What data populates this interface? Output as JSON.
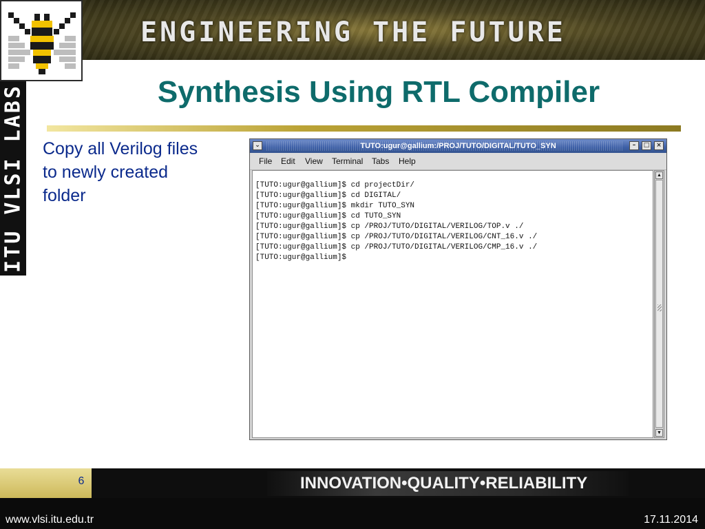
{
  "header": {
    "tagline": "ENGINEERING THE FUTURE",
    "vertical_label": "ITU VLSI LABS"
  },
  "slide": {
    "title": "Synthesis Using RTL Compiler",
    "body_lines": [
      "Copy all Verilog files",
      "to newly created",
      "folder"
    ]
  },
  "terminal": {
    "window_title": "TUTO:ugur@gallium:/PROJ/TUTO/DIGITAL/TUTO_SYN",
    "menu": [
      {
        "label": "File"
      },
      {
        "label": "Edit"
      },
      {
        "label": "View"
      },
      {
        "label": "Terminal"
      },
      {
        "label": "Tabs"
      },
      {
        "label": "Help"
      }
    ],
    "lines": [
      "[TUTO:ugur@gallium]$ cd projectDir/",
      "[TUTO:ugur@gallium]$ cd DIGITAL/",
      "[TUTO:ugur@gallium]$ mkdir TUTO_SYN",
      "[TUTO:ugur@gallium]$ cd TUTO_SYN",
      "[TUTO:ugur@gallium]$ cp /PROJ/TUTO/DIGITAL/VERILOG/TOP.v ./",
      "[TUTO:ugur@gallium]$ cp /PROJ/TUTO/DIGITAL/VERILOG/CNT_16.v ./",
      "[TUTO:ugur@gallium]$ cp /PROJ/TUTO/DIGITAL/VERILOG/CMP_16.v ./",
      "[TUTO:ugur@gallium]$"
    ]
  },
  "footer": {
    "page_number": "6",
    "slogan": "INNOVATION•QUALITY•RELIABILITY",
    "url": "www.vlsi.itu.edu.tr",
    "date": "17.11.2014"
  },
  "colors": {
    "title": "#0e6b6b",
    "body_text": "#0b2a8c",
    "gold": "#bba336"
  },
  "icons": [
    "bee-logo-icon",
    "window-menu-icon",
    "minimize-icon",
    "maximize-icon",
    "close-icon",
    "scroll-up-icon",
    "scroll-down-icon"
  ]
}
